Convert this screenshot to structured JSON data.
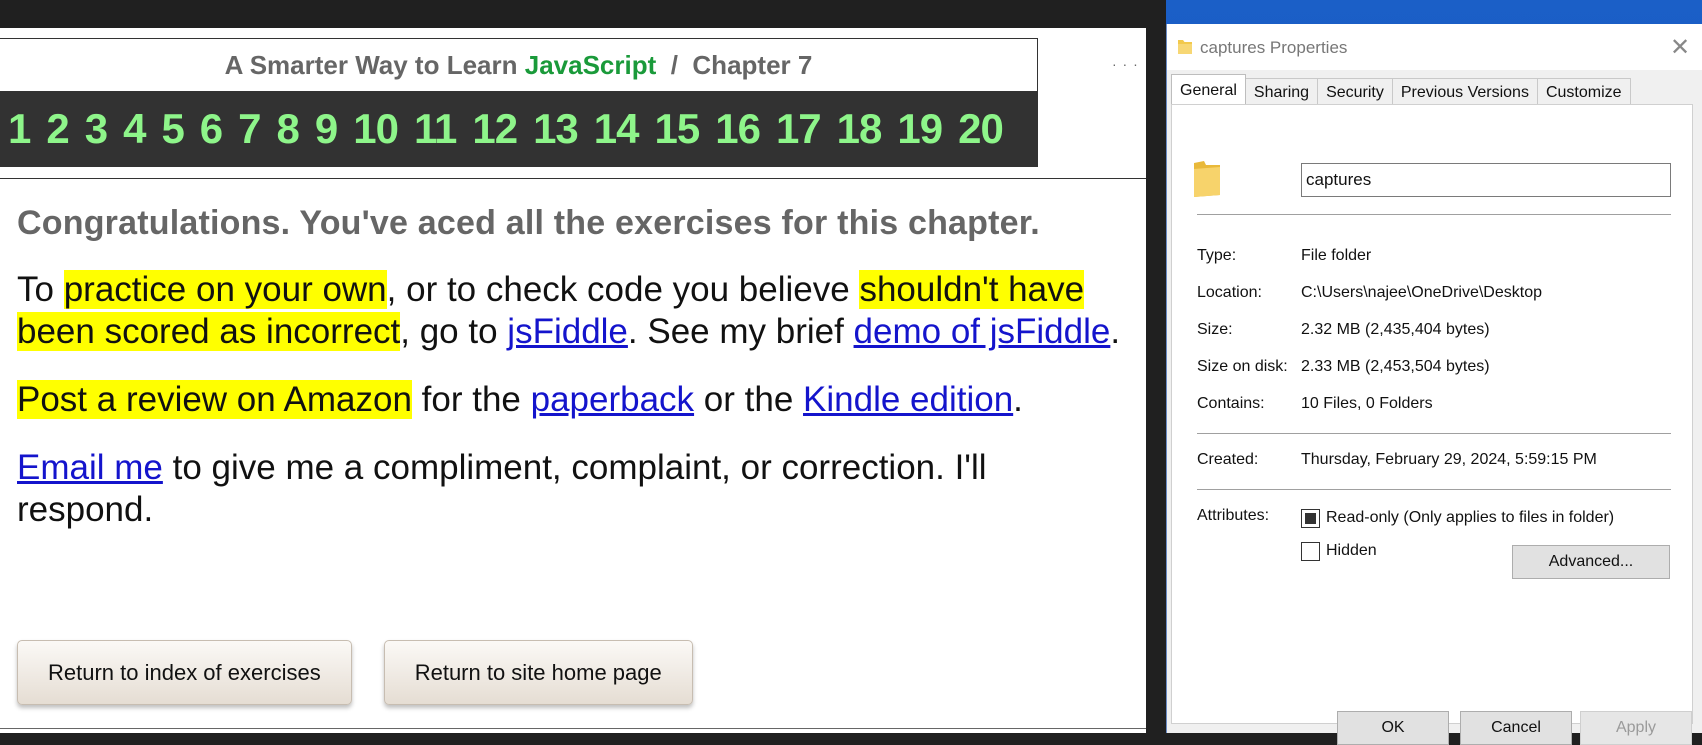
{
  "browser_page": {
    "book_title_prefix": "A Smarter Way to Learn",
    "book_title_js": "JavaScript",
    "book_title_sep": "/",
    "book_title_chapter": "Chapter 7",
    "chapter_links": [
      "1",
      "2",
      "3",
      "4",
      "5",
      "6",
      "7",
      "8",
      "9",
      "10",
      "11",
      "12",
      "13",
      "14",
      "15",
      "16",
      "17",
      "18",
      "19",
      "20"
    ],
    "dots": "· · ·",
    "congrats": "Congratulations. You've aced all the exercises for this chapter.",
    "para1": {
      "t1": "To ",
      "h1": "practice on your own",
      "t2": ", or to check code you believe ",
      "h2": "shouldn't have been scored as incorrect",
      "t3": ", go to ",
      "link1": "jsFiddle",
      "t4": ". See my brief ",
      "link2": "demo of jsFiddle",
      "t5": "."
    },
    "para2": {
      "h1": "Post a review on Amazon",
      "t1": " for the ",
      "link1": "paperback",
      "t2": " or the ",
      "link2": "Kindle edition",
      "t3": "."
    },
    "para3": {
      "link1": "Email me",
      "t1": " to give me a compliment, complaint, or correction. I'll respond."
    },
    "btn_index": "Return to index of exercises",
    "btn_home": "Return to site home page"
  },
  "dialog": {
    "title": "captures Properties",
    "close_glyph": "✕",
    "tabs": [
      "General",
      "Sharing",
      "Security",
      "Previous Versions",
      "Customize"
    ],
    "active_tab": "General",
    "folder_name": "captures",
    "type_label": "Type:",
    "type_value": "File folder",
    "location_label": "Location:",
    "location_value": "C:\\Users\\najee\\OneDrive\\Desktop",
    "size_label": "Size:",
    "size_value": "2.32 MB (2,435,404 bytes)",
    "size_on_disk_label": "Size on disk:",
    "size_on_disk_value": "2.33 MB (2,453,504 bytes)",
    "contains_label": "Contains:",
    "contains_value": "10 Files, 0 Folders",
    "created_label": "Created:",
    "created_value": "Thursday, February 29, 2024, 5:59:15 PM",
    "attributes_label": "Attributes:",
    "readonly_label": "Read-only (Only applies to files in folder)",
    "hidden_label": "Hidden",
    "advanced_btn": "Advanced...",
    "ok_btn": "OK",
    "cancel_btn": "Cancel",
    "apply_btn": "Apply"
  },
  "colors": {
    "highlight": "#ffff00",
    "link": "#1414cc",
    "chapter_nav_bg": "#323232",
    "chapter_num": "#8ef58a",
    "javascript_green": "#1a9a3a"
  }
}
